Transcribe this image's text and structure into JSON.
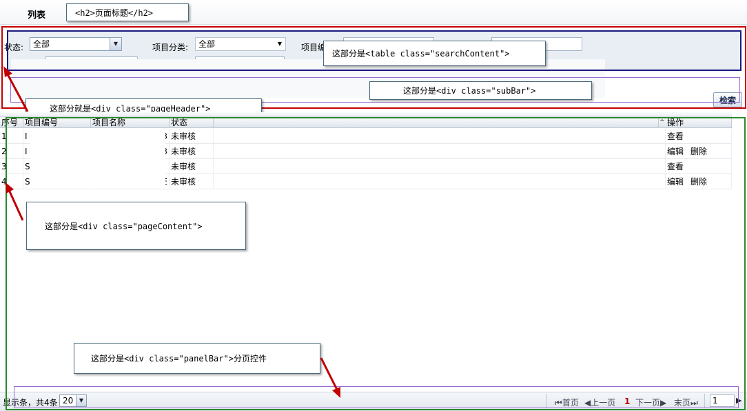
{
  "header": {
    "title": "列表"
  },
  "callouts": {
    "h2": "<h2>页面标题</h2>",
    "search": "这部分是<table class=\"searchContent\">",
    "subbar": "这部分是<div class=\"subBar\">",
    "page_header": "这部分就是<div class=\"pageHeader\">",
    "page_content": "这部分是<div class=\"pageContent\">",
    "panel_bar": "这部分是<div class=\"panelBar\">分页控件"
  },
  "search": {
    "status_label": "状态:",
    "status_value": "全部",
    "category_label": "项目分类:",
    "category_value": "全部",
    "code_label": "项目编",
    "search_button": "检索"
  },
  "table": {
    "headers": [
      "序号",
      "项目编号",
      "项目名称",
      "状态",
      "操作"
    ],
    "rows": [
      {
        "index": "1",
        "code": "I",
        "name": "3",
        "status": "未审核",
        "ops": [
          "查看"
        ]
      },
      {
        "index": "2",
        "code": "I",
        "name": "3",
        "status": "未审核",
        "ops": [
          "编辑",
          "删除"
        ]
      },
      {
        "index": "3",
        "code": "S",
        "name": "",
        "status": "未审核",
        "ops": [
          "查看"
        ]
      },
      {
        "index": "4",
        "code": "S",
        "name": "E",
        "status": "未审核",
        "ops": [
          "编辑",
          "删除"
        ]
      }
    ]
  },
  "pager": {
    "show_label": "显示条，共4条",
    "page_size": "20",
    "first": "首页",
    "prev": "上一页",
    "current": "1",
    "next": "下一页",
    "last": "末页",
    "goto_value": "1"
  },
  "colors": {
    "frame_red": "#c40000",
    "frame_navy": "#1a1a80",
    "frame_purple": "#9a6ad0",
    "frame_green": "#2a8a2a",
    "current_page": "#c00000"
  }
}
